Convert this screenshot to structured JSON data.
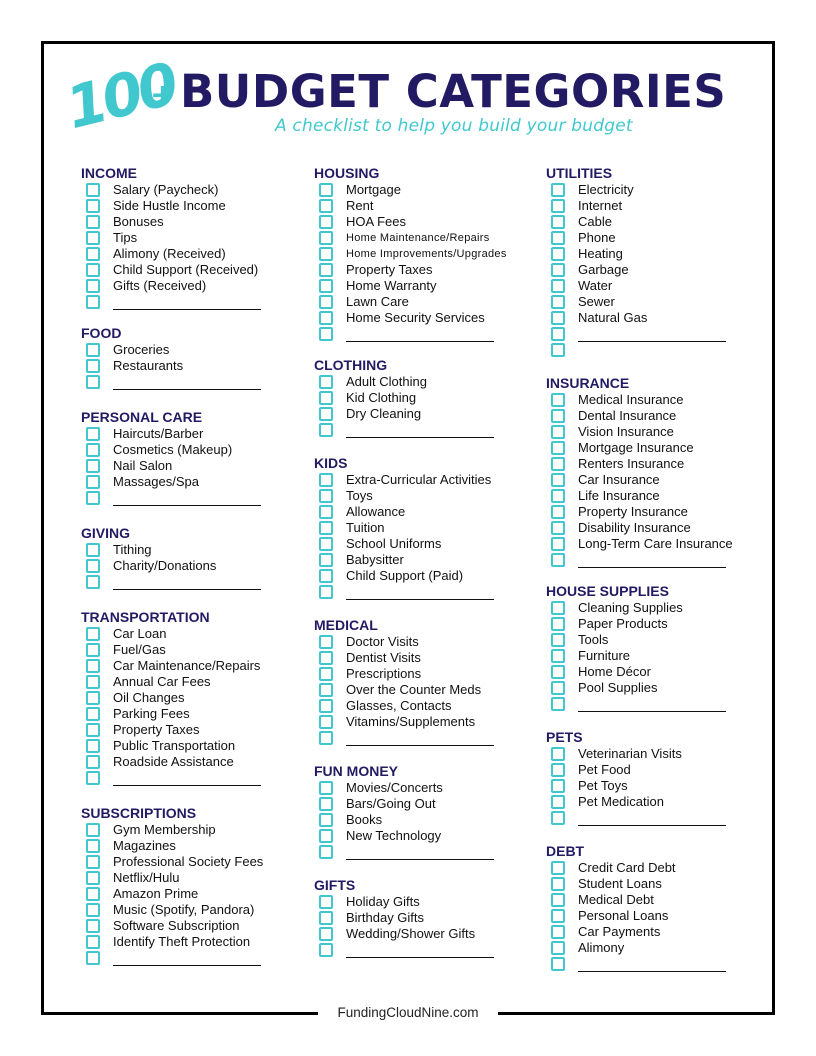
{
  "header": {
    "number": "100",
    "plus": "+",
    "title": "BUDGET CATEGORIES",
    "subtitle": "A checklist to help you build your budget"
  },
  "footer": {
    "text": "FundingCloudNine.com"
  },
  "colors": {
    "navy": "#221a63",
    "teal": "#41c8cf"
  },
  "columns": [
    {
      "sections": [
        {
          "title": "INCOME",
          "items": [
            "Salary (Paycheck)",
            "Side Hustle Income",
            "Bonuses",
            "Tips",
            "Alimony (Received)",
            "Child Support (Received)",
            "Gifts (Received)"
          ],
          "blanks": 1
        },
        {
          "title": "FOOD",
          "items": [
            "Groceries",
            "Restaurants"
          ],
          "blanks": 1
        },
        {
          "title": "PERSONAL CARE",
          "items": [
            "Haircuts/Barber",
            "Cosmetics (Makeup)",
            "Nail Salon",
            "Massages/Spa"
          ],
          "blanks": 1
        },
        {
          "title": "GIVING",
          "items": [
            "Tithing",
            "Charity/Donations"
          ],
          "blanks": 1
        },
        {
          "title": "TRANSPORTATION",
          "items": [
            "Car Loan",
            "Fuel/Gas",
            "Car Maintenance/Repairs",
            "Annual Car Fees",
            "Oil Changes",
            "Parking Fees",
            "Property Taxes",
            "Public Transportation",
            "Roadside Assistance"
          ],
          "blanks": 1
        },
        {
          "title": "SUBSCRIPTIONS",
          "items": [
            "Gym Membership",
            "Magazines",
            "Professional Society Fees",
            "Netflix/Hulu",
            "Amazon Prime",
            "Music (Spotify, Pandora)",
            "Software Subscription",
            "Identify Theft Protection"
          ],
          "blanks": 1
        }
      ]
    },
    {
      "sections": [
        {
          "title": "HOUSING",
          "items": [
            "Mortgage",
            "Rent",
            "HOA Fees",
            "Home  Maintenance/Repairs",
            "Home  Improvements/Upgrades",
            "Property Taxes",
            "Home Warranty",
            "Lawn Care",
            "Home Security Services"
          ],
          "small_items": [
            3,
            4
          ],
          "blanks": 1
        },
        {
          "title": "CLOTHING",
          "items": [
            "Adult Clothing",
            "Kid Clothing",
            "Dry Cleaning"
          ],
          "blanks": 1
        },
        {
          "title": "KIDS",
          "items": [
            "Extra-Curricular Activities",
            "Toys",
            "Allowance",
            "Tuition",
            "School Uniforms",
            "Babysitter",
            "Child Support (Paid)"
          ],
          "blanks": 1
        },
        {
          "title": "MEDICAL",
          "items": [
            "Doctor Visits",
            "Dentist Visits",
            "Prescriptions",
            "Over the Counter Meds",
            "Glasses, Contacts",
            "Vitamins/Supplements"
          ],
          "blanks": 1
        },
        {
          "title": "FUN MONEY",
          "items": [
            "Movies/Concerts",
            "Bars/Going Out",
            "Books",
            "New Technology"
          ],
          "blanks": 1
        },
        {
          "title": "GIFTS",
          "items": [
            "Holiday Gifts",
            "Birthday Gifts",
            "Wedding/Shower Gifts"
          ],
          "blanks": 1
        }
      ]
    },
    {
      "sections": [
        {
          "title": "UTILITIES",
          "items": [
            "Electricity",
            "Internet",
            "Cable",
            "Phone",
            "Heating",
            "Garbage",
            "Water",
            "Sewer",
            "Natural Gas"
          ],
          "blanks": 2
        },
        {
          "title": "INSURANCE",
          "items": [
            "Medical Insurance",
            "Dental Insurance",
            "Vision Insurance",
            "Mortgage Insurance",
            "Renters Insurance",
            "Car Insurance",
            "Life Insurance",
            "Property Insurance",
            "Disability Insurance",
            "Long-Term Care Insurance"
          ],
          "blanks": 1
        },
        {
          "title": "HOUSE SUPPLIES",
          "items": [
            "Cleaning Supplies",
            "Paper Products",
            "Tools",
            "Furniture",
            "Home Décor",
            "Pool Supplies"
          ],
          "blanks": 1
        },
        {
          "title": "PETS",
          "items": [
            "Veterinarian Visits",
            "Pet Food",
            "Pet Toys",
            "Pet Medication"
          ],
          "blanks": 1
        },
        {
          "title": "DEBT",
          "items": [
            "Credit Card Debt",
            "Student Loans",
            "Medical Debt",
            "Personal Loans",
            "Car Payments",
            "Alimony"
          ],
          "blanks": 1
        }
      ]
    }
  ]
}
